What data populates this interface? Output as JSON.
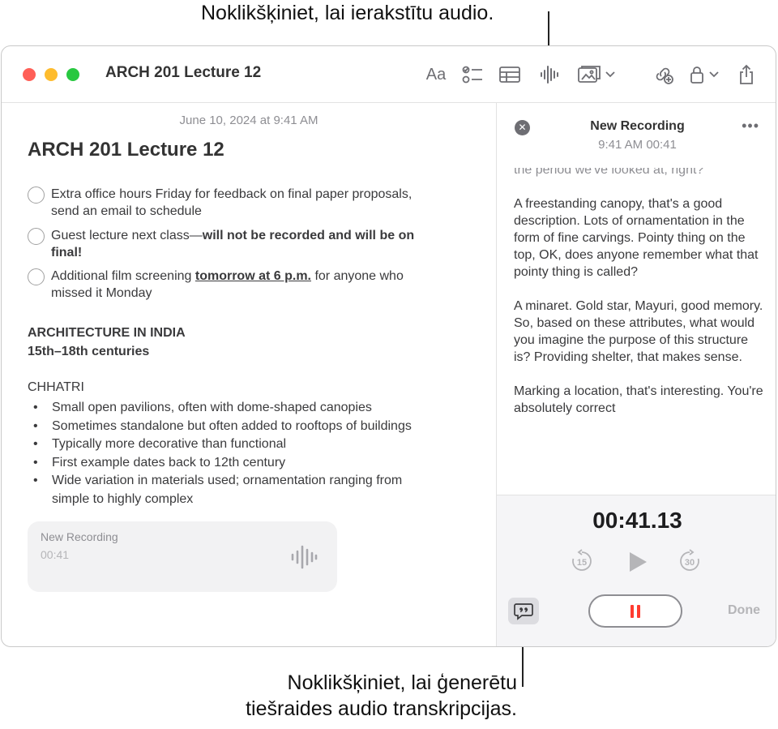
{
  "callouts": {
    "top": "Noklikšķiniet, lai ierakstītu audio.",
    "bottom_line1": "Noklikšķiniet, lai ģenerētu",
    "bottom_line2": "tiešraides audio transkripcijas."
  },
  "window": {
    "title": "ARCH 201 Lecture 12",
    "toolbar": {
      "format_label": "Aa",
      "icons": [
        "checklist-icon",
        "table-icon",
        "audio-waveform-icon",
        "media-icon",
        "chevron-down-icon",
        "collaborate-icon",
        "lock-icon",
        "share-icon"
      ]
    }
  },
  "note": {
    "date": "June 10, 2024 at 9:41 AM",
    "title": "ARCH 201 Lecture 12",
    "checklist": [
      {
        "line1": "Extra office hours Friday for feedback on final paper proposals,",
        "line2": "send an email to schedule"
      },
      {
        "prefix": "Guest lecture next class—",
        "bold_line1": "will not be recorded and will be on",
        "bold_line2": "final!"
      },
      {
        "prefix": "Additional film screening ",
        "underlined": "tomorrow at 6 p.m.",
        "suffix": " for anyone who",
        "line2": "missed it Monday"
      }
    ],
    "section_heading": "ARCHITECTURE IN INDIA",
    "section_subheading": "15th–18th centuries",
    "subsection": "CHHATRI",
    "bullets": [
      {
        "line1": "Small open pavilions, often with dome-shaped canopies"
      },
      {
        "line1": "Sometimes standalone but often added to rooftops of buildings"
      },
      {
        "line1": "Typically more decorative than functional"
      },
      {
        "line1": "First example dates back to 12th century"
      },
      {
        "line1": "Wide variation in materials used; ornamentation ranging from",
        "line2": "simple to highly complex"
      }
    ],
    "bullet_char": "•",
    "audio_card": {
      "name": "New Recording",
      "time": "00:41"
    }
  },
  "panel": {
    "close_glyph": "✕",
    "title": "New Recording",
    "subtitle": "9:41 AM  00:41",
    "more_glyph": "•••",
    "transcript_fade": "the period we've looked at, right?",
    "transcript": [
      "A freestanding canopy, that's a good description. Lots of ornamentation in the form of fine carvings. Pointy thing on the top, OK, does anyone remember what that pointy thing is called?",
      "A minaret. Gold star, Mayuri, good memory. So, based on these attributes, what would you imagine the purpose of this structure is? Providing shelter, that makes sense.",
      "Marking a location, that's interesting. You're absolutely correct"
    ],
    "timer": "00:41.13",
    "skip_back": "15",
    "skip_forward": "30",
    "done_label": "Done",
    "accent_record": "#ff3b30"
  }
}
